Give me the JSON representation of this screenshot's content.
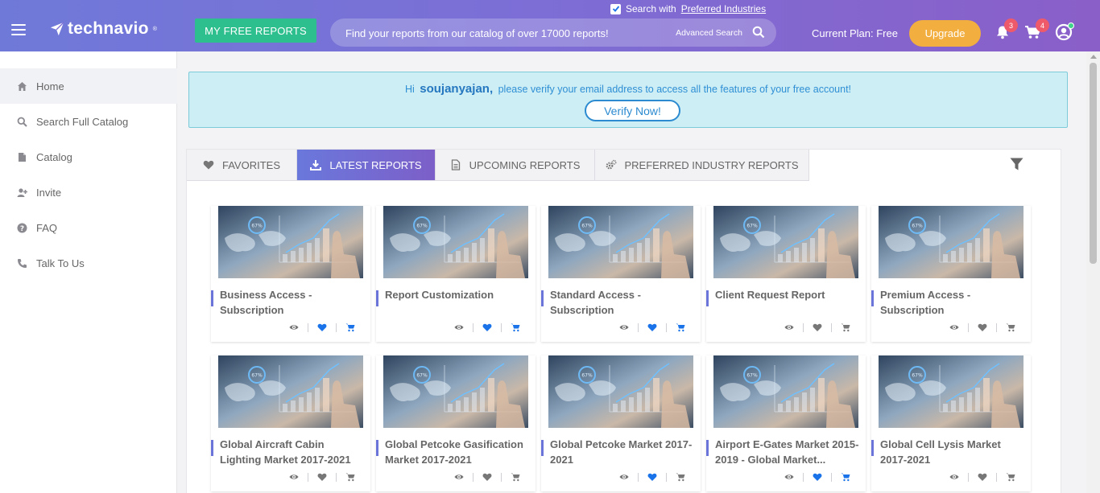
{
  "header": {
    "brand": "technavio",
    "brand_tm": "®",
    "free_reports_label": "MY FREE REPORTS",
    "search_placeholder": "Find your reports from our catalog of over 17000 reports!",
    "advanced_search_label": "Advanced Search",
    "preferred_prefix": "Search with",
    "preferred_link": "Preferred Industries",
    "preferred_checked": true,
    "plan_label": "Current Plan: Free",
    "upgrade_label": "Upgrade",
    "notifications_count": "3",
    "cart_count": "4",
    "accent_color": "#7b6fd6"
  },
  "sidebar": {
    "items": [
      {
        "label": "Home",
        "icon": "home-icon",
        "active": true
      },
      {
        "label": "Search Full Catalog",
        "icon": "search-icon",
        "active": false
      },
      {
        "label": "Catalog",
        "icon": "document-icon",
        "active": false
      },
      {
        "label": "Invite",
        "icon": "user-plus-icon",
        "active": false
      },
      {
        "label": "FAQ",
        "icon": "question-icon",
        "active": false
      },
      {
        "label": "Talk To Us",
        "icon": "phone-icon",
        "active": false
      }
    ]
  },
  "banner": {
    "greeting": "Hi",
    "username": "soujanyajan,",
    "message": "please verify your email address to access all the features of your free account!",
    "verify_label": "Verify Now!"
  },
  "tabs": [
    {
      "label": "FAVORITES",
      "icon": "heart-icon",
      "active": false
    },
    {
      "label": "LATEST REPORTS",
      "icon": "download-icon",
      "active": true
    },
    {
      "label": "UPCOMING REPORTS",
      "icon": "file-icon",
      "active": false
    },
    {
      "label": "PREFERRED INDUSTRY REPORTS",
      "icon": "gears-icon",
      "active": false
    }
  ],
  "reports": [
    {
      "title": "Business Access - Subscription",
      "favorited": true,
      "in_cart": true
    },
    {
      "title": "Report Customization",
      "favorited": true,
      "in_cart": true
    },
    {
      "title": "Standard Access - Subscription",
      "favorited": true,
      "in_cart": true
    },
    {
      "title": "Client Request Report",
      "favorited": false,
      "in_cart": false
    },
    {
      "title": "Premium Access - Subscription",
      "favorited": false,
      "in_cart": false
    },
    {
      "title": "Global Aircraft Cabin Lighting Market 2017-2021",
      "favorited": false,
      "in_cart": false
    },
    {
      "title": "Global Petcoke Gasification Market 2017-2021",
      "favorited": false,
      "in_cart": false
    },
    {
      "title": "Global Petcoke Market 2017-2021",
      "favorited": true,
      "in_cart": false
    },
    {
      "title": "Airport E-Gates Market 2015-2019 - Global Market...",
      "favorited": true,
      "in_cart": true
    },
    {
      "title": "Global Cell Lysis Market 2017-2021",
      "favorited": false,
      "in_cart": false
    }
  ],
  "thumbnail_badge": "67%",
  "colors": {
    "active_icon": "#1a73e8",
    "inactive_icon": "#777777"
  }
}
